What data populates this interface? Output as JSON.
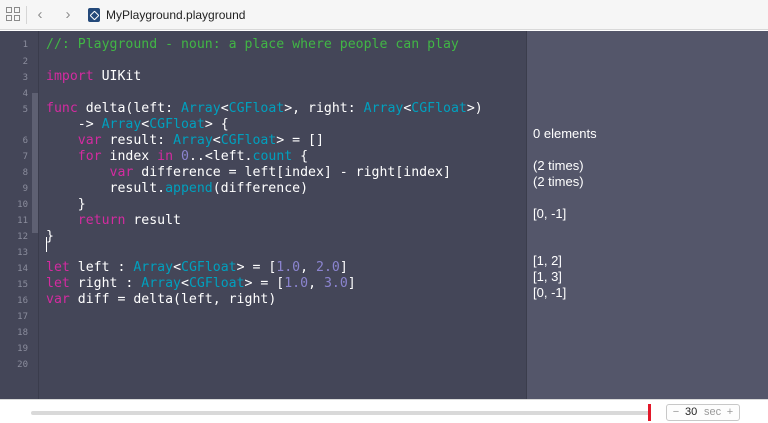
{
  "navbar": {
    "file_title": "MyPlayground.playground",
    "back_glyph": "‹",
    "forward_glyph": "›",
    "icons": [
      "related-items-grid-icon",
      "chevron-left-icon",
      "chevron-right-icon",
      "playground-file-icon"
    ]
  },
  "editor": {
    "line_numbers": [
      "1",
      "2",
      "3",
      "4",
      "5",
      "6",
      "7",
      "8",
      "9",
      "10",
      "11",
      "12",
      "13",
      "14",
      "15",
      "16",
      "17",
      "18",
      "19",
      "20"
    ],
    "lines": [
      [
        {
          "t": "//: Playground - noun: a place where people can play",
          "c": "com"
        }
      ],
      [],
      [
        {
          "t": "import",
          "c": "kw"
        },
        {
          "t": " UIKit",
          "c": "id"
        }
      ],
      [],
      [
        {
          "t": "func",
          "c": "kw"
        },
        {
          "t": " delta(left: ",
          "c": "id"
        },
        {
          "t": "Array",
          "c": "typ"
        },
        {
          "t": "<",
          "c": "id"
        },
        {
          "t": "CGFloat",
          "c": "typ"
        },
        {
          "t": ">, right: ",
          "c": "id"
        },
        {
          "t": "Array",
          "c": "typ"
        },
        {
          "t": "<",
          "c": "id"
        },
        {
          "t": "CGFloat",
          "c": "typ"
        },
        {
          "t": ">)",
          "c": "id"
        }
      ],
      [
        {
          "t": "    -> ",
          "c": "id"
        },
        {
          "t": "Array",
          "c": "typ"
        },
        {
          "t": "<",
          "c": "id"
        },
        {
          "t": "CGFloat",
          "c": "typ"
        },
        {
          "t": "> {",
          "c": "id"
        }
      ],
      [
        {
          "t": "    ",
          "c": "id"
        },
        {
          "t": "var",
          "c": "kw"
        },
        {
          "t": " result: ",
          "c": "id"
        },
        {
          "t": "Array",
          "c": "typ"
        },
        {
          "t": "<",
          "c": "id"
        },
        {
          "t": "CGFloat",
          "c": "typ"
        },
        {
          "t": "> = []",
          "c": "id"
        }
      ],
      [
        {
          "t": "    ",
          "c": "id"
        },
        {
          "t": "for",
          "c": "kw"
        },
        {
          "t": " index ",
          "c": "id"
        },
        {
          "t": "in",
          "c": "kw"
        },
        {
          "t": " ",
          "c": "id"
        },
        {
          "t": "0",
          "c": "num"
        },
        {
          "t": "..<left.",
          "c": "id"
        },
        {
          "t": "count",
          "c": "fn"
        },
        {
          "t": " {",
          "c": "id"
        }
      ],
      [
        {
          "t": "        ",
          "c": "id"
        },
        {
          "t": "var",
          "c": "kw"
        },
        {
          "t": " difference = left[index] - right[index]",
          "c": "id"
        }
      ],
      [
        {
          "t": "        result.",
          "c": "id"
        },
        {
          "t": "append",
          "c": "fn"
        },
        {
          "t": "(difference)",
          "c": "id"
        }
      ],
      [
        {
          "t": "    }",
          "c": "id"
        }
      ],
      [
        {
          "t": "    ",
          "c": "id"
        },
        {
          "t": "return",
          "c": "kw"
        },
        {
          "t": " result",
          "c": "id"
        }
      ],
      [
        {
          "t": "}",
          "c": "id"
        }
      ],
      [],
      [
        {
          "t": "let",
          "c": "kw"
        },
        {
          "t": " left : ",
          "c": "id"
        },
        {
          "t": "Array",
          "c": "typ"
        },
        {
          "t": "<",
          "c": "id"
        },
        {
          "t": "CGFloat",
          "c": "typ"
        },
        {
          "t": "> = [",
          "c": "id"
        },
        {
          "t": "1.0",
          "c": "num"
        },
        {
          "t": ", ",
          "c": "id"
        },
        {
          "t": "2.0",
          "c": "num"
        },
        {
          "t": "]",
          "c": "id"
        }
      ],
      [
        {
          "t": "let",
          "c": "kw"
        },
        {
          "t": " right : ",
          "c": "id"
        },
        {
          "t": "Array",
          "c": "typ"
        },
        {
          "t": "<",
          "c": "id"
        },
        {
          "t": "CGFloat",
          "c": "typ"
        },
        {
          "t": "> = [",
          "c": "id"
        },
        {
          "t": "1.0",
          "c": "num"
        },
        {
          "t": ", ",
          "c": "id"
        },
        {
          "t": "3.0",
          "c": "num"
        },
        {
          "t": "]",
          "c": "id"
        }
      ],
      [
        {
          "t": "var",
          "c": "kw"
        },
        {
          "t": " diff = delta(left, right)",
          "c": "id"
        }
      ]
    ]
  },
  "results": {
    "line6": "0 elements",
    "line8": "(2 times)",
    "line9": "(2 times)",
    "line11": "[0, -1]",
    "line14": "[1, 2]",
    "line15": "[1, 3]",
    "line16": "[0, -1]"
  },
  "timeline": {
    "minus": "−",
    "plus": "+",
    "value": "30",
    "unit": "sec"
  },
  "colors": {
    "editor_bg": "#444658",
    "results_bg": "#54566a",
    "comment": "#41b645",
    "keyword": "#d32ba0",
    "type": "#00a0be",
    "number": "#8b84cf",
    "playhead": "#e2182a"
  }
}
